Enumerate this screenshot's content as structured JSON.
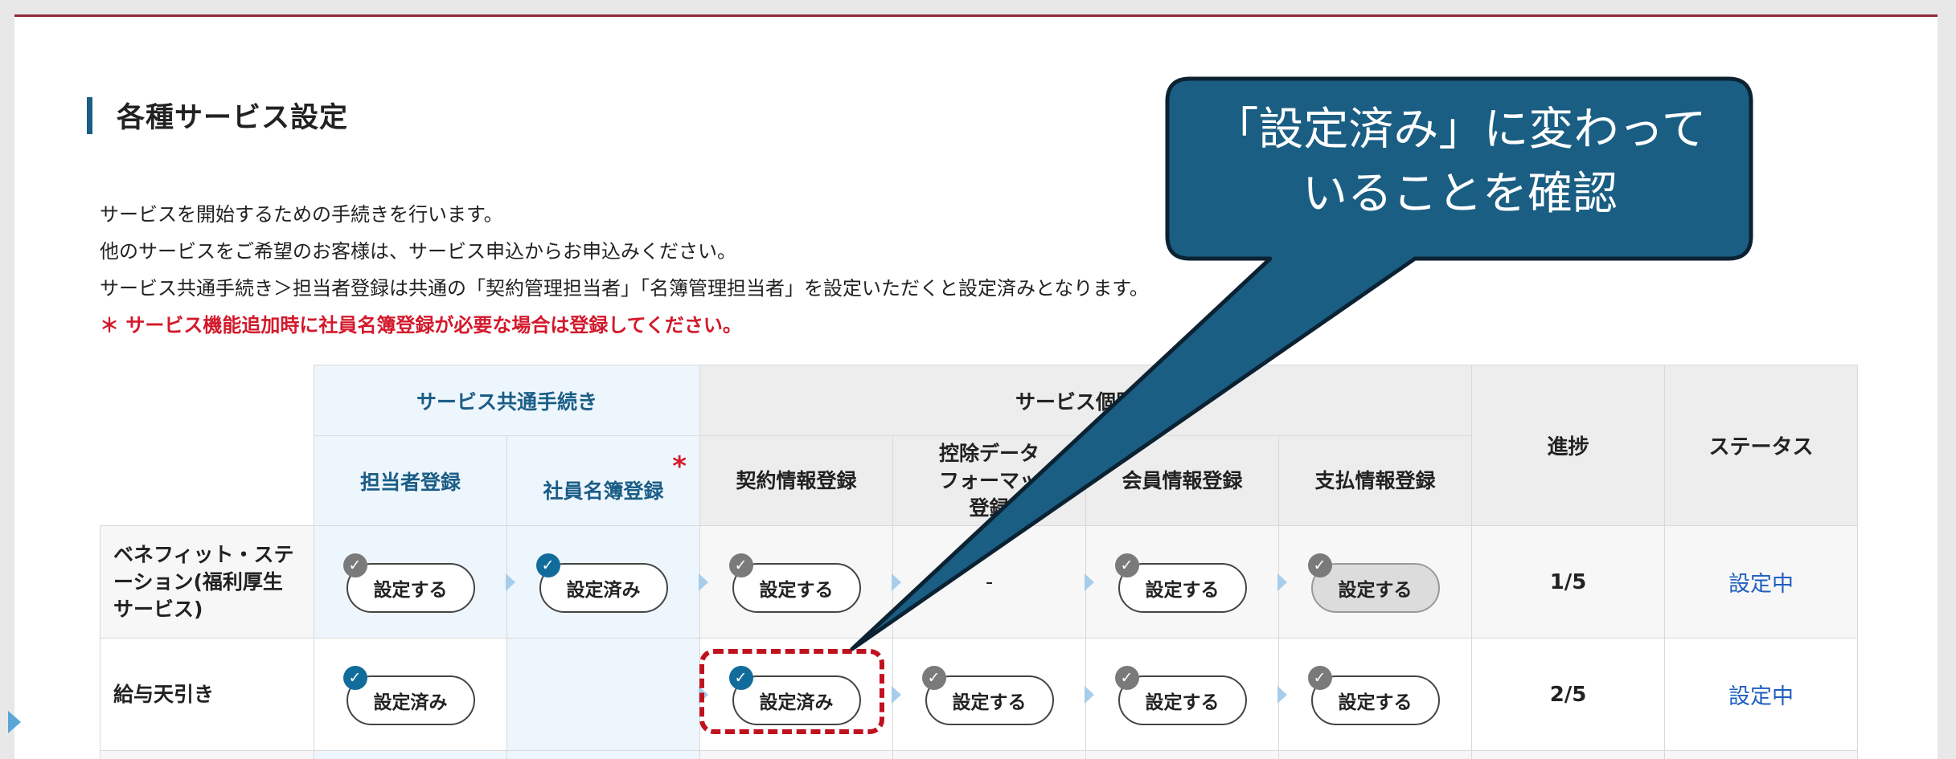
{
  "section_title": "各種サービス設定",
  "description": [
    "サービスを開始するための手続きを行います。",
    "他のサービスをご希望のお客様は、サービス申込からお申込みください。",
    "サービス共通手続き＞担当者登録は共通の「契約管理担当者」「名簿管理担当者」を設定いただくと設定済みとなります。"
  ],
  "notice": "＊ サービス機能追加時に社員名簿登録が必要な場合は登録してください。",
  "table": {
    "group_common": "サービス共通手続き",
    "group_individual": "サービス個別手",
    "col_progress": "進捗",
    "col_status": "ステータス",
    "col_tanto": "担当者登録",
    "col_meibo": "社員名簿登録",
    "col_keiyaku": "契約情報登録",
    "col_kojo": "控除データ\nフォーマッ\n登録",
    "col_kaiin": "会員情報登録",
    "col_shiharai": "支払情報登録",
    "asterisk": "*",
    "rows": [
      {
        "label": "ベネフィット・ステ\nーション(福利厚生\nサービス)",
        "tanto": "設定する",
        "meibo": "設定済み",
        "keiyaku": "設定する",
        "kojo": "-",
        "kaiin": "設定する",
        "shiharai": "設定する",
        "progress": "1/5",
        "status": "設定中"
      },
      {
        "label": "給与天引き",
        "tanto": "設定済み",
        "keiyaku": "設定済み",
        "kojo": "設定する",
        "kaiin": "設定する",
        "shiharai": "設定する",
        "progress": "2/5",
        "status": "設定中"
      }
    ]
  },
  "callout": {
    "line1": "「設定済み」に変わって",
    "line2": "いることを確認"
  },
  "colors": {
    "accent": "#1a5d86",
    "callout_fill": "#1a5e83",
    "highlight": "#c0111f",
    "notice": "#d3192b",
    "done_badge": "#116c9c",
    "pending_badge": "#7a7a7a"
  }
}
